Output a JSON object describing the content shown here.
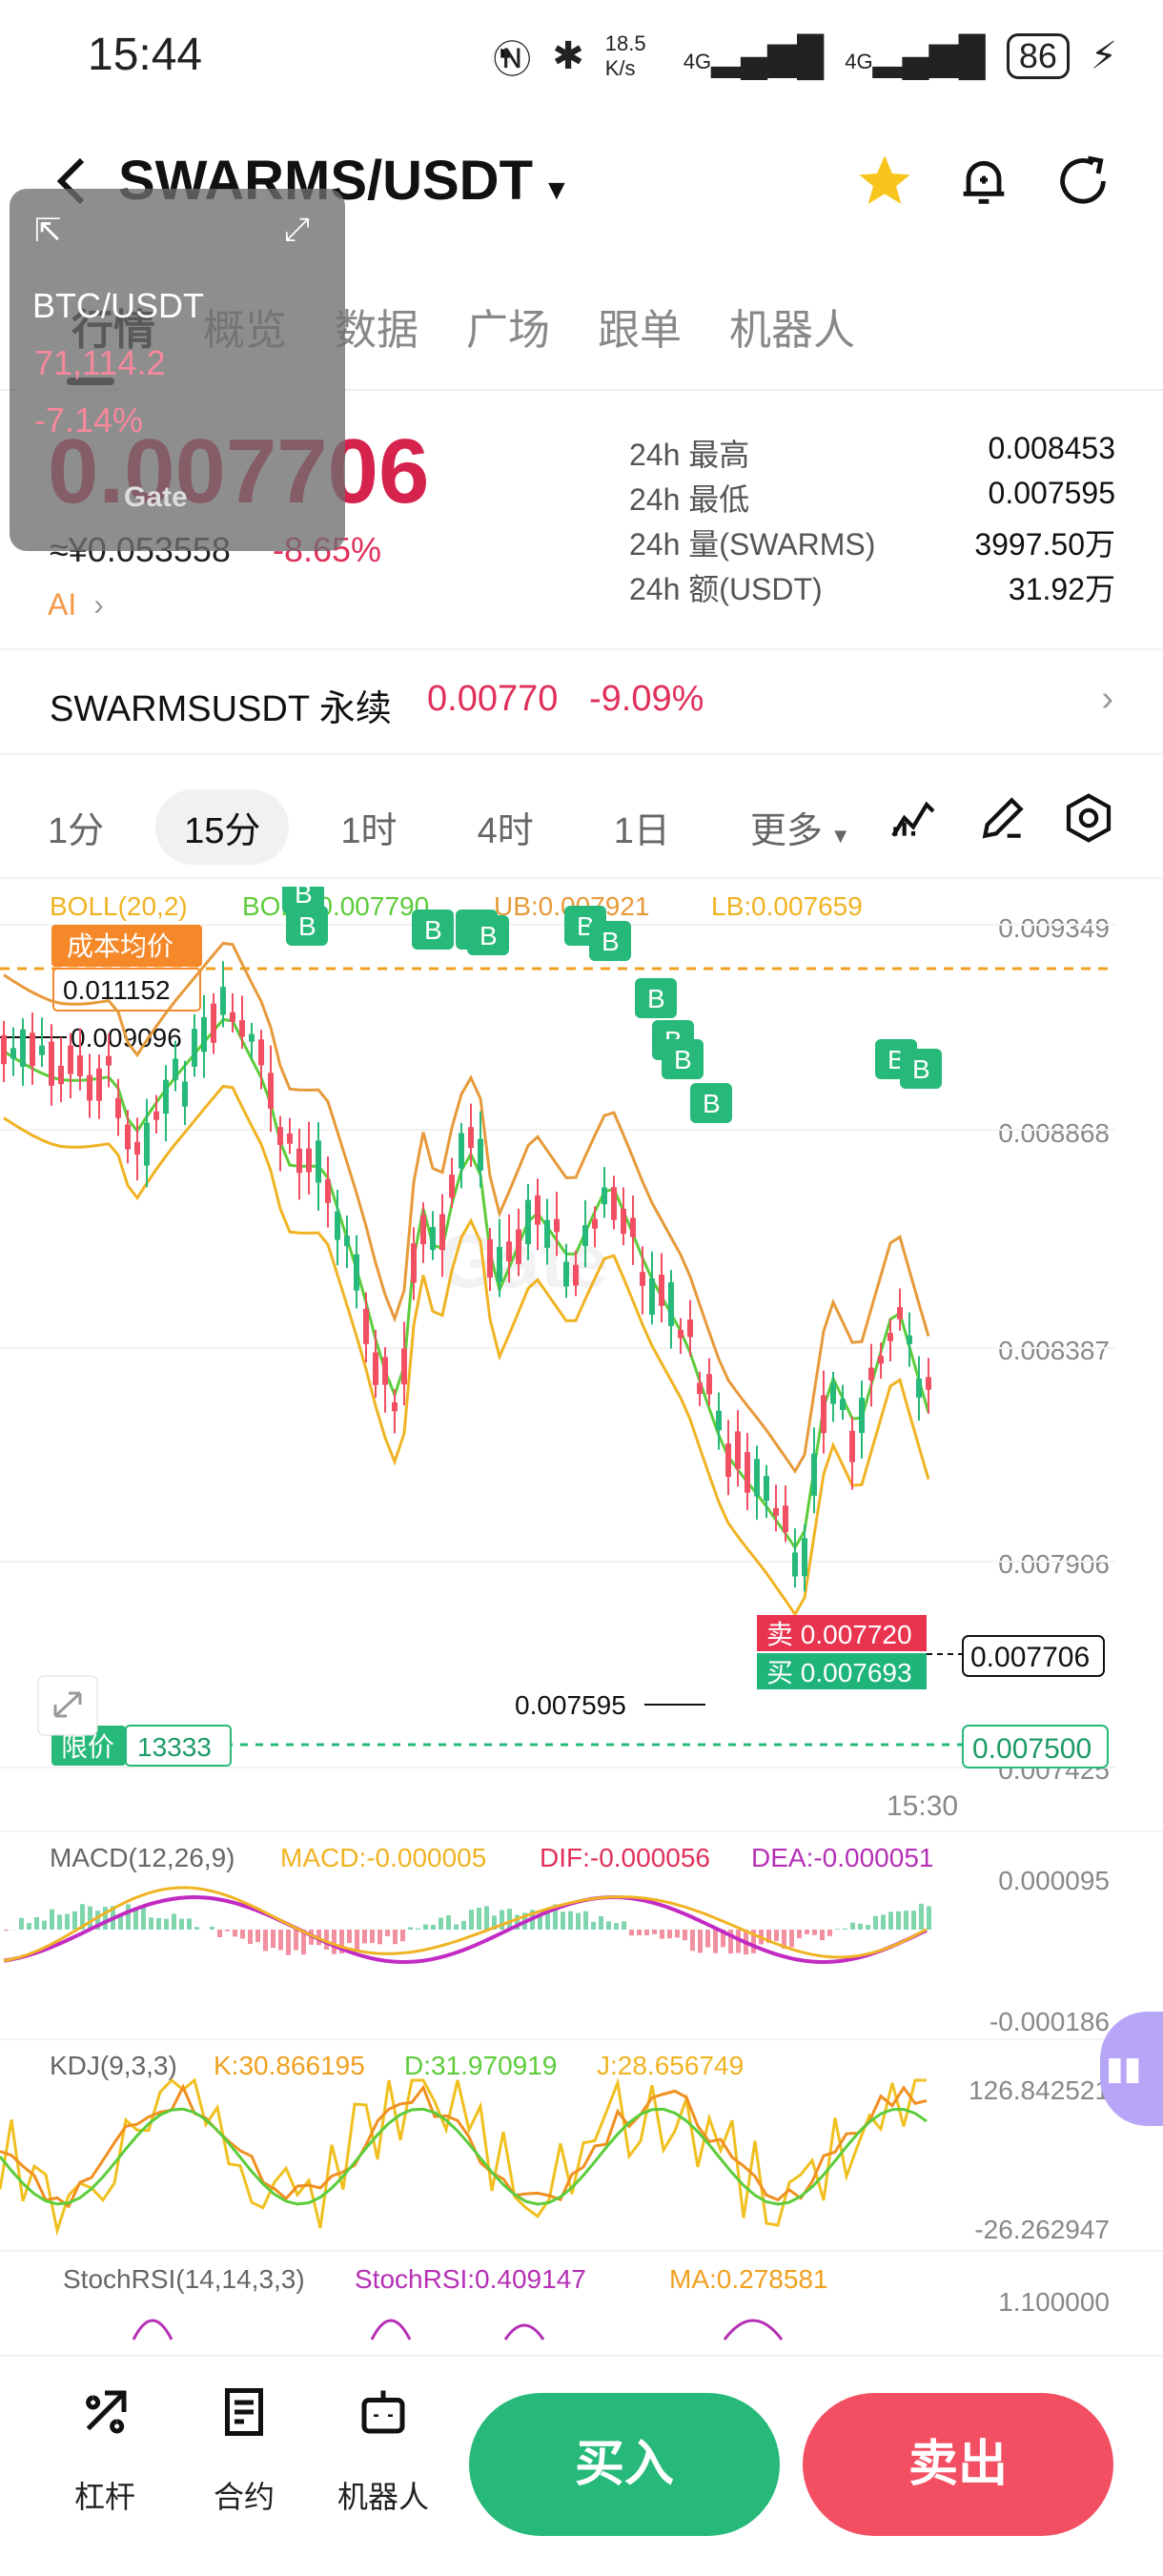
{
  "status_bar": {
    "time": "15:44",
    "speed": "18.5 K/s",
    "net1": "4G",
    "net2": "4G",
    "battery": "86"
  },
  "header": {
    "title": "SWARMS/USDT"
  },
  "tabs": [
    {
      "label": "行情",
      "active": true
    },
    {
      "label": "概览"
    },
    {
      "label": "数据"
    },
    {
      "label": "广场"
    },
    {
      "label": "跟单"
    },
    {
      "label": "机器人"
    }
  ],
  "price": {
    "last": "0.007706",
    "cny": "≈¥0.053558",
    "change": "-8.65%",
    "ai": "AI"
  },
  "stats": [
    {
      "label": "24h  最高",
      "value": "0.008453"
    },
    {
      "label": "24h  最低",
      "value": "0.007595"
    },
    {
      "label": "24h  量(SWARMS)",
      "value": "3997.50万"
    },
    {
      "label": "24h  额(USDT)",
      "value": "31.92万"
    }
  ],
  "perp": {
    "name": "SWARMSUSDT 永续",
    "price": "0.00770",
    "change": "-9.09%"
  },
  "intervals": [
    {
      "label": "1分"
    },
    {
      "label": "15分",
      "active": true
    },
    {
      "label": "1时"
    },
    {
      "label": "4时"
    },
    {
      "label": "1日"
    },
    {
      "label": "更多"
    }
  ],
  "mini_window": {
    "pair": "BTC/USDT",
    "price": "71,114.2",
    "change": "-7.14%",
    "logo": "Gate"
  },
  "chart": {
    "boll_label": "BOLL(20,2)",
    "boll_value": "BOLL:0.007790",
    "ub": "UB:0.007921",
    "lb": "LB:0.007659",
    "cost_label": "成本均价",
    "cost_value": "0.011152",
    "high_marker": "0.009096",
    "low_marker": "0.007595",
    "y_ticks": [
      "0.009349",
      "0.008868",
      "0.008387",
      "0.007906",
      "0.007425"
    ],
    "sell_label": "卖 0.007720",
    "buy_label": "买 0.007693",
    "current": "0.007706",
    "limit_label": "限价",
    "limit_qty": "13333",
    "limit_price": "0.007500",
    "time_label": "15:30",
    "watermark": "Gate",
    "buy_marker": "B"
  },
  "macd": {
    "title": "MACD(12,26,9)",
    "macd": "MACD:-0.000005",
    "dif": "DIF:-0.000056",
    "dea": "DEA:-0.000051",
    "top": "0.000095",
    "bottom": "-0.000186"
  },
  "kdj": {
    "title": "KDJ(9,3,3)",
    "k": "K:30.866195",
    "d": "D:31.970919",
    "j": "J:28.656749",
    "top": "126.842521",
    "bottom": "-26.262947"
  },
  "stoch": {
    "title": "StochRSI(14,14,3,3)",
    "rsi": "StochRSI:0.409147",
    "ma": "MA:0.278581",
    "top": "1.100000"
  },
  "bottom_nav": [
    {
      "label": "杠杆"
    },
    {
      "label": "合约"
    },
    {
      "label": "机器人"
    }
  ],
  "buy_button": "买入",
  "sell_button": "卖出",
  "colors": {
    "up": "#27b97a",
    "down": "#f24f63",
    "boll_mid": "#5ccc3b",
    "boll_ub": "#e69a3a",
    "boll_lb": "#f0b323"
  }
}
